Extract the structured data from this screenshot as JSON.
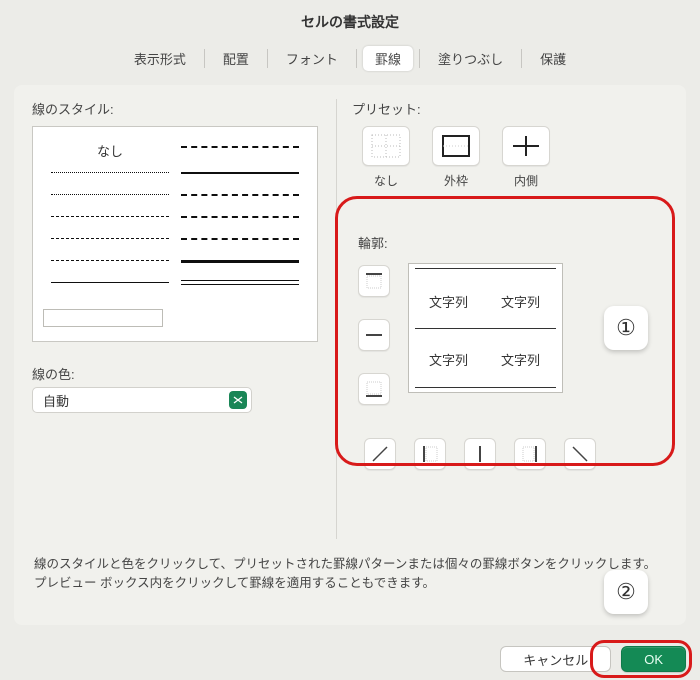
{
  "title": "セルの書式設定",
  "tabs": {
    "display_format": "表示形式",
    "alignment": "配置",
    "font": "フォント",
    "border": "罫線",
    "fill": "塗りつぶし",
    "protection": "保護"
  },
  "labels": {
    "line_style": "線のスタイル:",
    "none": "なし",
    "line_color": "線の色:",
    "color_value": "自動",
    "presets": "プリセット:",
    "outline_section": "輪郭:"
  },
  "presets": {
    "none": "なし",
    "outline": "外枠",
    "inside": "内側"
  },
  "preview_text": {
    "sample": "文字列"
  },
  "annotations": {
    "circle1": "①",
    "circle2": "②"
  },
  "help": "線のスタイルと色をクリックして、プリセットされた罫線パターンまたは個々の罫線ボタンをクリックします。プレビュー ボックス内をクリックして罫線を適用することもできます。",
  "buttons": {
    "cancel": "キャンセル",
    "ok": "OK"
  }
}
